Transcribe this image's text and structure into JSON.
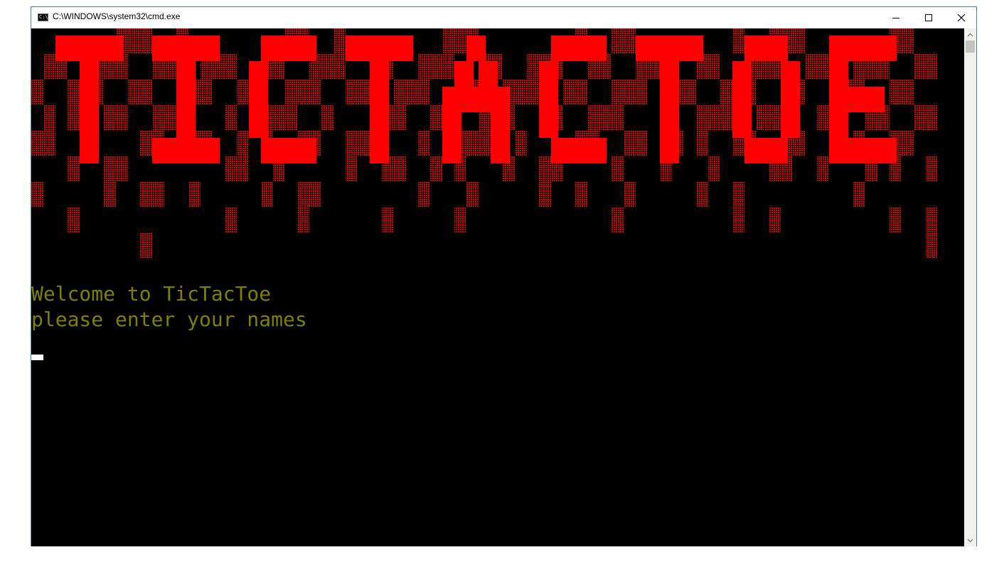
{
  "window": {
    "title": "C:\\WINDOWS\\system32\\cmd.exe",
    "icon": "cmd-icon"
  },
  "controls": {
    "minimize": "minimize-icon",
    "maximize": "maximize-icon",
    "close": "close-icon"
  },
  "banner": {
    "text": "TICTACTOE",
    "color": "#ff0000",
    "shade_color": "#c00000"
  },
  "console": {
    "lines": [
      "Welcome to TicTacToe",
      "please enter your names"
    ],
    "text_color": "#808000",
    "cursor_color": "#ffffff"
  }
}
